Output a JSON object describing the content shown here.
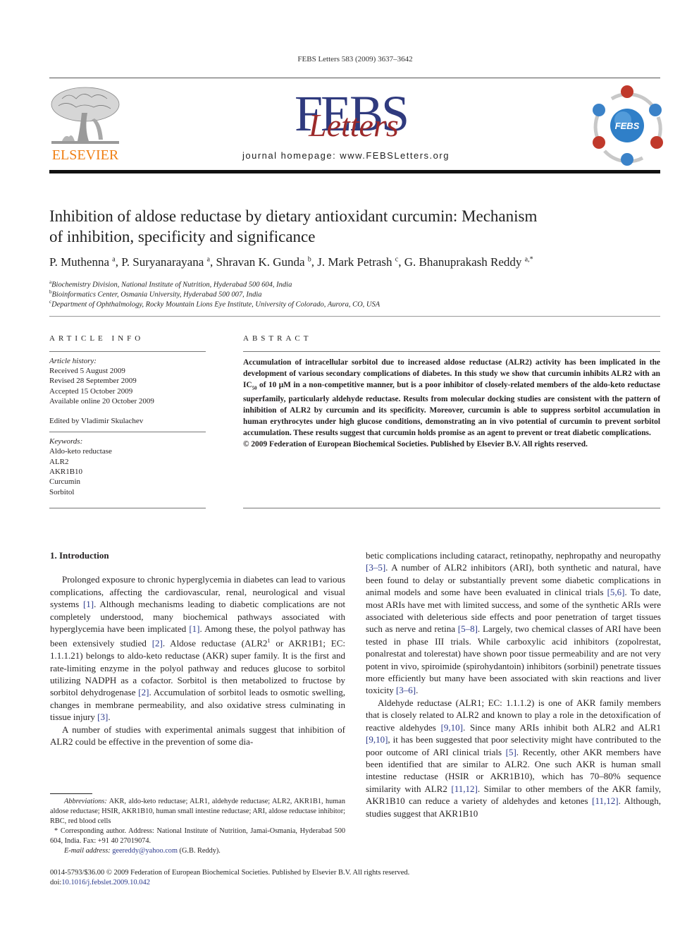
{
  "header": {
    "journal_ref": "FEBS Letters 583 (2009) 3637–3642",
    "publisher_logo_text": "ELSEVIER",
    "journal_logo_main": "FEBS",
    "journal_logo_sub": "Letters",
    "homepage": "journal homepage: www.FEBSLetters.org",
    "society_logo_text": "FEBS",
    "colors": {
      "elsevier_orange": "#f07f13",
      "febs_blue": "#2f3a7e",
      "febs_red": "#9c2a2a",
      "logo_blue": "#3b82c8",
      "logo_red": "#c0392b",
      "ref_link": "#2c3a8c"
    }
  },
  "article": {
    "title_line1": "Inhibition of aldose reductase by dietary antioxidant curcumin: Mechanism",
    "title_line2": "of inhibition, specificity and significance",
    "authors": [
      {
        "name": "P. Muthenna",
        "sup": "a"
      },
      {
        "name": "P. Suryanarayana",
        "sup": "a"
      },
      {
        "name": "Shravan K. Gunda",
        "sup": "b"
      },
      {
        "name": "J. Mark Petrash",
        "sup": "c"
      },
      {
        "name": "G. Bhanuprakash Reddy",
        "sup": "a,*"
      }
    ],
    "affiliations": [
      {
        "sup": "a",
        "text": "Biochemistry Division, National Institute of Nutrition, Hyderabad 500 604, India"
      },
      {
        "sup": "b",
        "text": "Bioinformatics Center, Osmania University, Hyderabad 500 007, India"
      },
      {
        "sup": "c",
        "text": "Department of Ophthalmology, Rocky Mountain Lions Eye Institute, University of Colorado, Aurora, CO, USA"
      }
    ]
  },
  "article_info": {
    "heading": "ARTICLE INFO",
    "history_label": "Article history:",
    "history": [
      "Received 5 August 2009",
      "Revised 28 September 2009",
      "Accepted 15 October 2009",
      "Available online 20 October 2009"
    ],
    "edited_by": "Edited by Vladimir Skulachev",
    "keywords_label": "Keywords:",
    "keywords": [
      "Aldo-keto reductase",
      "ALR2",
      "AKR1B10",
      "Curcumin",
      "Sorbitol"
    ]
  },
  "abstract": {
    "heading": "ABSTRACT",
    "text_a": "Accumulation of intracellular sorbitol due to increased aldose reductase (ALR2) activity has been implicated in the development of various secondary complications of diabetes. In this study we show that curcumin inhibits ALR2 with an IC",
    "text_sub": "50",
    "text_b": " of 10 μM in a non-competitive manner, but is a poor inhibitor of closely-related members of the aldo-keto reductase superfamily, particularly aldehyde reductase. Results from molecular docking studies are consistent with the pattern of inhibition of ALR2 by curcumin and its specificity. Moreover, curcumin is able to suppress sorbitol accumulation in human erythrocytes under high glucose conditions, demonstrating an in vivo potential of curcumin to prevent sorbitol accumulation. These results suggest that curcumin holds promise as an agent to prevent or treat diabetic complications.",
    "copyright": "© 2009 Federation of European Biochemical Societies. Published by Elsevier B.V. All rights reserved."
  },
  "body": {
    "section_heading": "1. Introduction",
    "p1": [
      {
        "t": "Prolonged exposure to chronic hyperglycemia in diabetes can lead to various complications, affecting the cardiovascular, renal, neurological and visual systems "
      },
      {
        "r": "[1]"
      },
      {
        "t": ". Although mechanisms leading to diabetic complications are not completely understood, many biochemical pathways associated with hyperglycemia have been implicated "
      },
      {
        "r": "[1]"
      },
      {
        "t": ". Among these, the polyol pathway has been extensively studied "
      },
      {
        "r": "[2]"
      },
      {
        "t": ". Aldose reductase (ALR2"
      },
      {
        "s": "1"
      },
      {
        "t": " or AKR1B1; EC: 1.1.1.21) belongs to aldo-keto reductase (AKR) super family. It is the first and rate-limiting enzyme in the polyol pathway and reduces glucose to sorbitol utilizing NADPH as a cofactor. Sorbitol is then metabolized to fructose by sorbitol dehydrogenase "
      },
      {
        "r": "[2]"
      },
      {
        "t": ". Accumulation of sorbitol leads to osmotic swelling, changes in membrane permeability, and also oxidative stress culminating in tissue injury "
      },
      {
        "r": "[3]"
      },
      {
        "t": "."
      }
    ],
    "p2": [
      {
        "t": "A number of studies with experimental animals suggest that inhibition of ALR2 could be effective in the prevention of some diabetic complications including cataract, retinopathy, nephropathy and neuropathy "
      },
      {
        "r": "[3–5]"
      },
      {
        "t": ". A number of ALR2 inhibitors (ARI), both synthetic and natural, have been found to delay or substantially prevent some diabetic complications in animal models and some have been evaluated in clinical trials "
      },
      {
        "r": "[5,6]"
      },
      {
        "t": ". To date, most ARIs have met with limited success, and some of the synthetic ARIs were associated with deleterious side effects and poor penetration of target tissues such as nerve and retina "
      },
      {
        "r": "[5–8]"
      },
      {
        "t": ". Largely, two chemical classes of ARI have been tested in phase III trials. While carboxylic acid inhibitors (zopolrestat, ponalrestat and tolerestat) have shown poor tissue permeability and are not very potent in vivo, spiroimide (spirohydantoin) inhibitors (sorbinil) penetrate tissues more efficiently but many have been associated with skin reactions and liver toxicity "
      },
      {
        "r": "[3–6]"
      },
      {
        "t": "."
      }
    ],
    "p3": [
      {
        "t": "Aldehyde reductase (ALR1; EC: 1.1.1.2) is one of AKR family members that is closely related to ALR2 and known to play a role in the detoxification of reactive aldehydes "
      },
      {
        "r": "[9,10]"
      },
      {
        "t": ". Since many ARIs inhibit both ALR2 and ALR1 "
      },
      {
        "r": "[9,10]"
      },
      {
        "t": ", it has been suggested that poor selectivity might have contributed to the poor outcome of ARI clinical trials "
      },
      {
        "r": "[5]"
      },
      {
        "t": ". Recently, other AKR members have been identified that are similar to ALR2. One such AKR is human small intestine reductase (HSIR or AKR1B10), which has 70–80% sequence similarity with ALR2 "
      },
      {
        "r": "[11,12]"
      },
      {
        "t": ". Similar to other members of the AKR family, AKR1B10 can reduce a variety of aldehydes and ketones "
      },
      {
        "r": "[11,12]"
      },
      {
        "t": ". Although, studies suggest that AKR1B10"
      }
    ]
  },
  "footnotes": {
    "abbrev_label": "Abbreviations:",
    "abbrev_text": " AKR, aldo-keto reductase; ALR1, aldehyde reductase; ALR2, AKR1B1, human aldose reductase; HSIR, AKR1B10, human small intestine reductase; ARI, aldose reductase inhibitor; RBC, red blood cells",
    "corresponding": "* Corresponding author. Address: National Institute of Nutrition, Jamai-Osmania, Hyderabad 500 604, India. Fax: +91 40 27019074.",
    "email_label": "E-mail address:",
    "email": "geereddy@yahoo.com",
    "email_suffix": " (G.B. Reddy)."
  },
  "bottom": {
    "issn_line": "0014-5793/$36.00 © 2009 Federation of European Biochemical Societies. Published by Elsevier B.V. All rights reserved.",
    "doi_prefix": "doi:",
    "doi": "10.1016/j.febslet.2009.10.042"
  }
}
